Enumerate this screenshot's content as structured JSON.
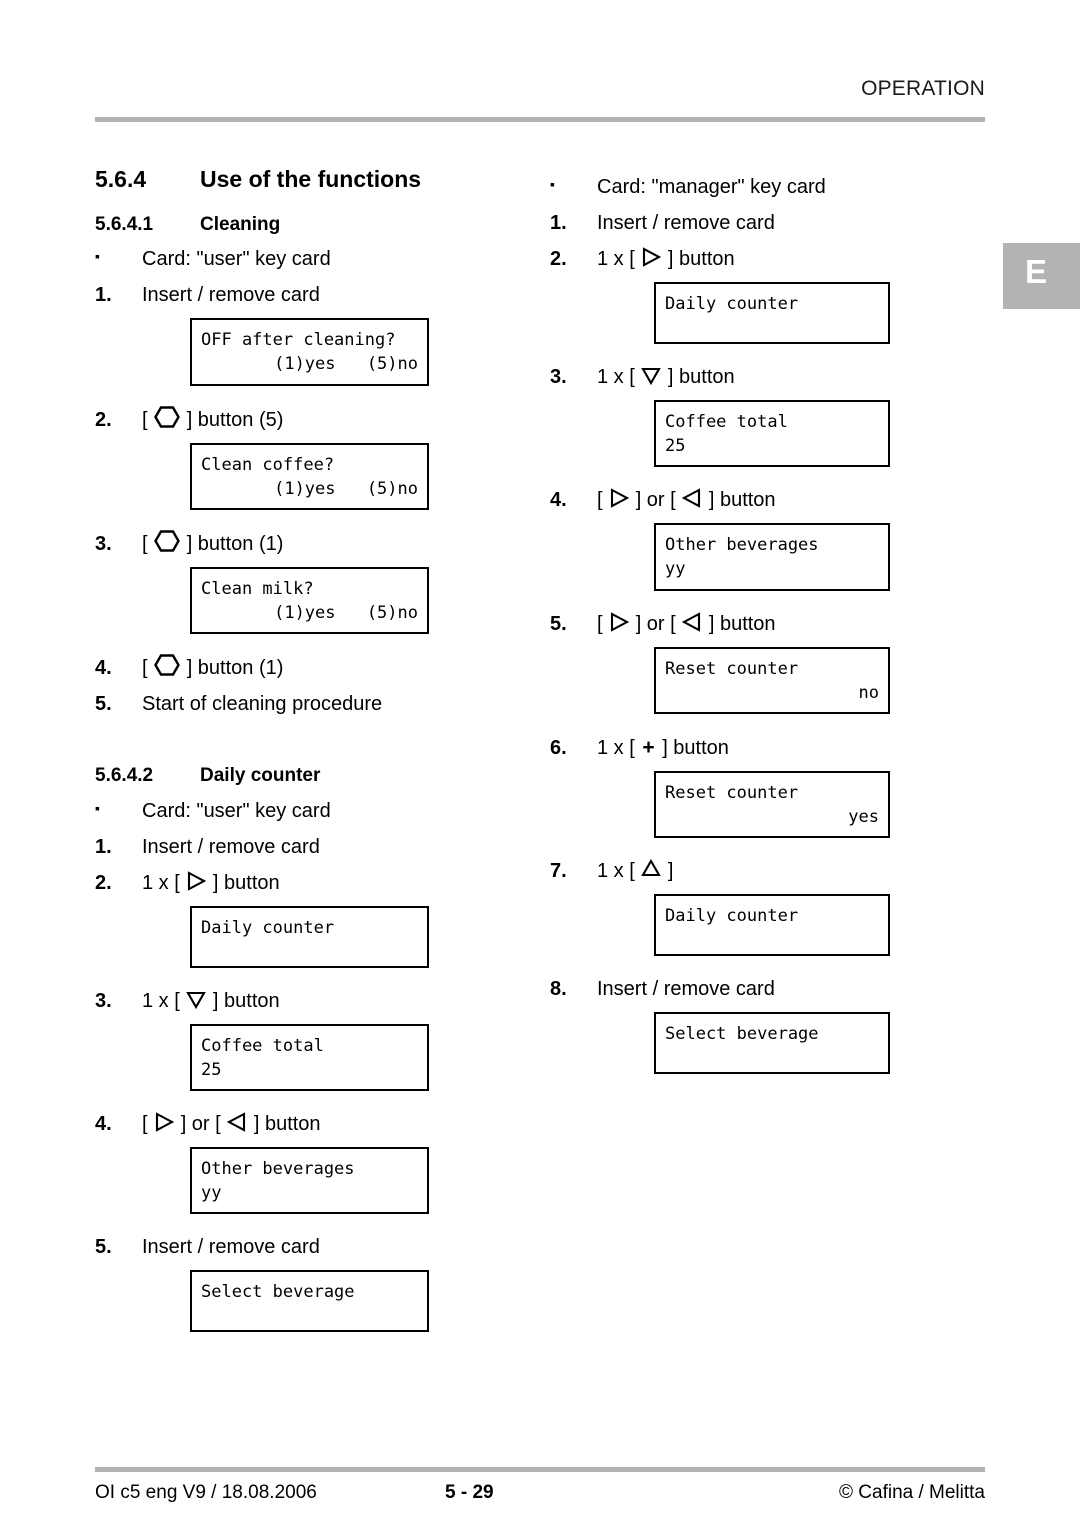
{
  "header": {
    "title": "OPERATION",
    "edge_tab": "E"
  },
  "left_column": {
    "section": {
      "number": "5.6.4",
      "title": "Use of the functions"
    },
    "subsection": {
      "number": "5.6.4.1",
      "title": "Cleaning"
    },
    "steps": [
      {
        "marker": "▪",
        "text": "Card: \"user\" key card"
      },
      {
        "marker": "1.",
        "text": "Insert / remove card"
      },
      {
        "marker": "2.",
        "text": "[ ⬡ ] button (5)"
      },
      {
        "marker": "3.",
        "text": "[ ⬡ ] button (1)"
      },
      {
        "marker": "4.",
        "text": "[ ⬡ ] button (1)"
      },
      {
        "marker": "5.",
        "text": "Start of cleaning procedure"
      }
    ],
    "displays": {
      "off_after_cleaning": {
        "line1": "OFF after cleaning?",
        "line2_left": "(1)yes",
        "line2_right": "(5)no"
      },
      "clean_coffee": {
        "line1": "Clean coffee?",
        "line2_left": "(1)yes",
        "line2_right": "(5)no"
      },
      "clean_milk": {
        "line1": "Clean milk?",
        "line2_left": "(1)yes",
        "line2_right": "(5)no"
      }
    },
    "subsection2": {
      "number": "5.6.4.2",
      "title": "Daily counter"
    },
    "steps2": [
      {
        "marker": "▪",
        "text": "Card: \"user\" key card"
      },
      {
        "marker": "1.",
        "text": "Insert / remove card"
      },
      {
        "marker": "2.",
        "text": "1 x [ ▷ ] button"
      },
      {
        "marker": "3.",
        "text": "1 x [ ▽ ] button"
      },
      {
        "marker": "4.",
        "text": "[ ▷ ] or [ ◁ ] button"
      },
      {
        "marker": "5.",
        "text": "Insert / remove card"
      }
    ],
    "displays2": {
      "daily_counter": {
        "line1": "Daily counter",
        "line2": ""
      },
      "coffee_total": {
        "line1": "Coffee total",
        "line2": "25"
      },
      "other_beverages": {
        "line1": "Other beverages",
        "line2": "yy"
      },
      "select_beverage": {
        "line1": "Select beverage",
        "line2": ""
      }
    }
  },
  "right_column": {
    "steps": [
      {
        "marker": "▪",
        "text": "Card: \"manager\" key card"
      },
      {
        "marker": "1.",
        "text": "Insert / remove card"
      },
      {
        "marker": "2.",
        "text": "1 x [ ▷ ] button"
      },
      {
        "marker": "3.",
        "text": "1 x [ ▽ ] button"
      },
      {
        "marker": "4.",
        "text": "[ ▷ ] or [ ◁ ] button"
      },
      {
        "marker": "5.",
        "text": "[ ▷ ] or [ ◁ ] button"
      },
      {
        "marker": "6.",
        "text": "1 x [ + ] button"
      },
      {
        "marker": "7.",
        "text": "1 x [ △ ]"
      },
      {
        "marker": "8.",
        "text": "Insert / remove card"
      }
    ],
    "displays": {
      "daily_counter_1": {
        "line1": "Daily counter",
        "line2": ""
      },
      "coffee_total": {
        "line1": "Coffee total",
        "line2": "25"
      },
      "other_beverages": {
        "line1": "Other beverages",
        "line2": "yy"
      },
      "reset_counter_no": {
        "line1": "Reset counter",
        "line2": "no"
      },
      "reset_counter_yes": {
        "line1": "Reset counter",
        "line2": "yes"
      },
      "daily_counter_2": {
        "line1": "Daily counter",
        "line2": ""
      },
      "select_beverage": {
        "line1": "Select beverage",
        "line2": ""
      }
    }
  },
  "footer": {
    "document_id": "OI c5 eng V9 / 18.08.2006",
    "page_number": "5 - 29",
    "copyright": "© Cafina / Melitta"
  },
  "colors": {
    "rule": "#b3b3b3",
    "tab": "#b3b3b3",
    "text": "#000000"
  }
}
